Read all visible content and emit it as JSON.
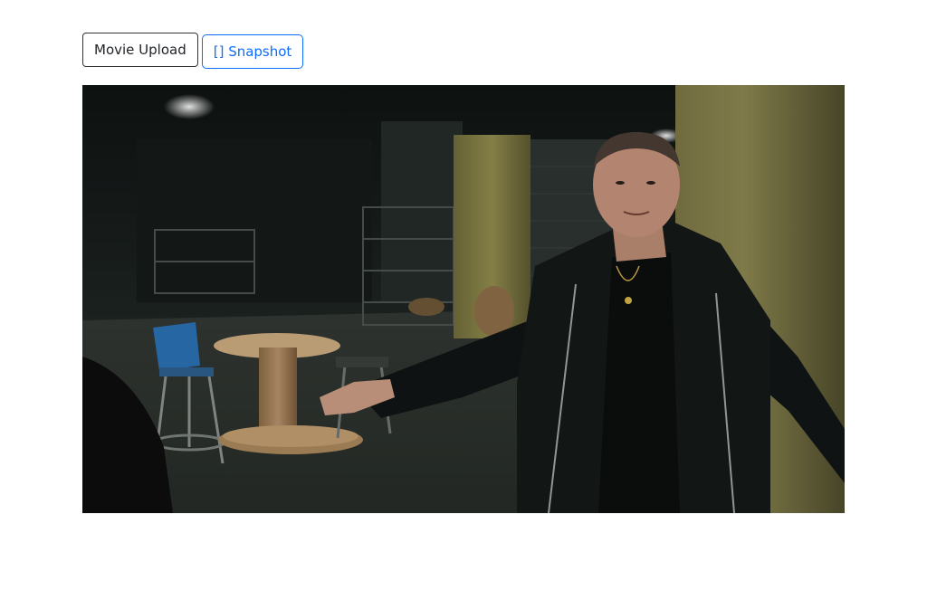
{
  "toolbar": {
    "upload_label": "Movie Upload",
    "snapshot_label": "[] Snapshot"
  },
  "video": {
    "icon": "video-frame",
    "scene": "warehouse"
  },
  "colors": {
    "snapshot_accent": "#0d6efd",
    "upload_border": "#333333",
    "background": "#ffffff"
  }
}
